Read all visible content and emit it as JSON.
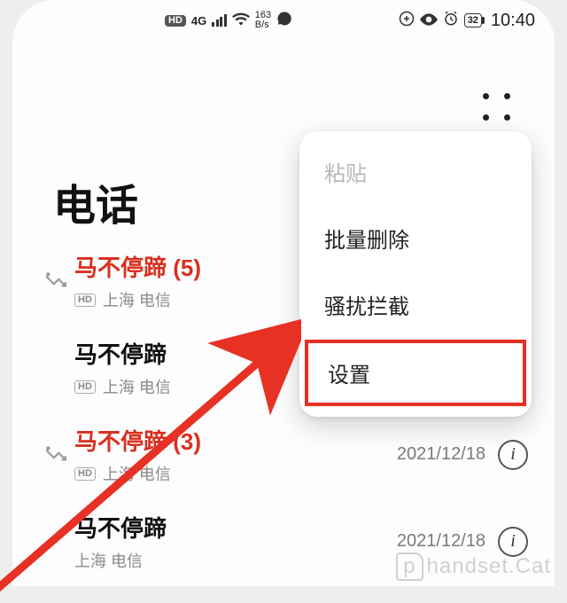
{
  "status": {
    "hd": "HD",
    "net_gen": "4G",
    "speed_top": "163",
    "speed_bot": "B/s",
    "battery": "32",
    "time": "10:40"
  },
  "page_title": "电话",
  "calls": [
    {
      "name": "马不停蹄 (5)",
      "missed": true,
      "hd": "HD",
      "loc": "上海 电信",
      "date": ""
    },
    {
      "name": "马不停蹄",
      "missed": false,
      "hd": "HD",
      "loc": "上海 电信",
      "date": ""
    },
    {
      "name": "马不停蹄 (3)",
      "missed": true,
      "hd": "HD",
      "loc": "上海 电信",
      "date": "2021/12/18"
    },
    {
      "name": "马不停蹄",
      "missed": false,
      "hd": "",
      "loc": "上海 电信",
      "date": "2021/12/18"
    }
  ],
  "menu": {
    "paste": "粘贴",
    "batch_delete": "批量删除",
    "block": "骚扰拦截",
    "settings": "设置"
  },
  "info_glyph": "i",
  "watermark": "handset.Cat"
}
